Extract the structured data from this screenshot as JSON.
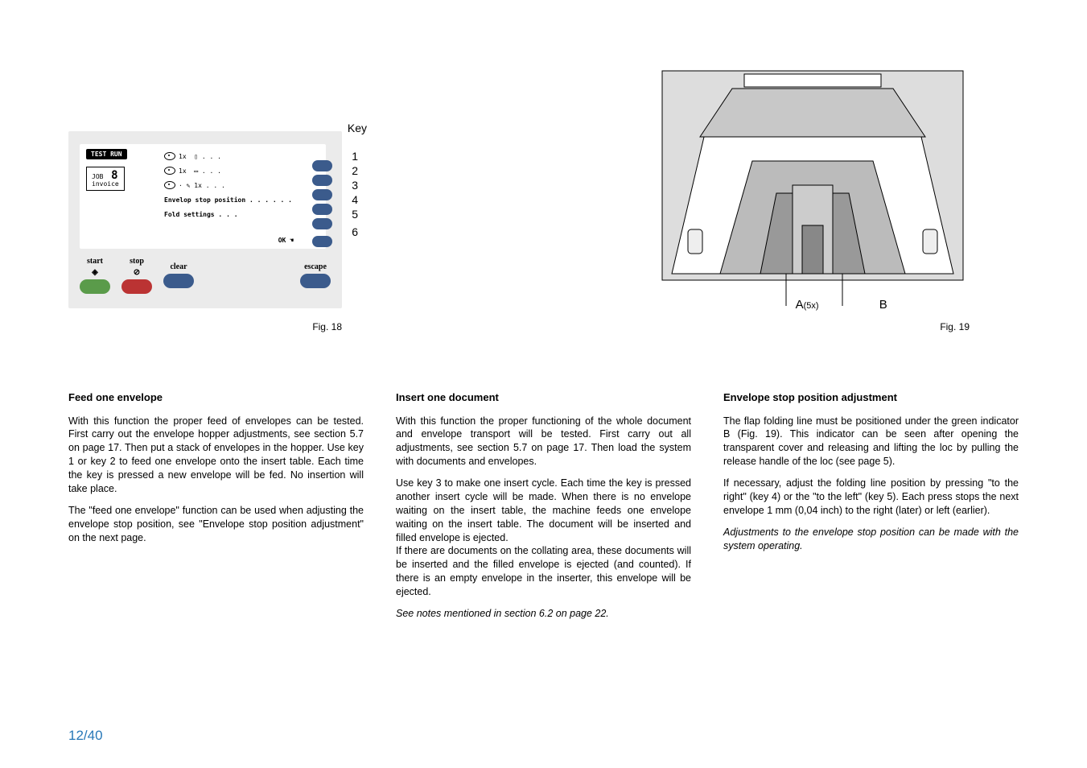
{
  "panel": {
    "test_run": "TEST RUN",
    "job_label": "JOB",
    "job_name": "invoice",
    "job_number": "8",
    "rows": [
      {
        "text": "1x"
      },
      {
        "text": "1x"
      },
      {
        "text": "1x"
      },
      {
        "text": "Envelop stop\nposition . . . . . ."
      },
      {
        "text": "Fold settings . . ."
      }
    ],
    "ok": "OK",
    "key_title": "Key",
    "keys": [
      "1",
      "2",
      "3",
      "4",
      "5",
      "6"
    ],
    "buttons": {
      "start": "start",
      "stop": "stop",
      "clear": "clear",
      "escape": "escape"
    }
  },
  "fig18_caption": "Fig. 18",
  "fig19_caption": "Fig. 19",
  "fig19_labels": {
    "A": "A",
    "A5x": "(5x)",
    "B": "B"
  },
  "col1": {
    "title": "Feed one envelope",
    "p1": "With this function the proper feed of envelopes can be tested. First carry out the envelope hopper adjustments, see section 5.7 on page 17. Then put a stack of envelopes in the hopper. Use key 1 or key 2 to feed one envelope onto the insert table. Each time the key is pressed a new envelope will be fed. No insertion will take place.",
    "p2": "The \"feed one envelope\" function can be used when adjusting the envelope stop position, see \"Envelope stop position adjustment\" on the next page."
  },
  "col2": {
    "title": "Insert one document",
    "p1": "With this function the proper functioning of the whole document and envelope transport will be tested. First carry out all adjustments, see section 5.7 on page 17. Then load the system with documents and envelopes.",
    "p2": "Use key 3 to make one insert cycle. Each time the key is pressed another insert cycle will be made. When there is no envelope waiting on the insert table, the machine feeds one envelope waiting on the insert table. The document will be inserted and filled envelope is ejected.",
    "p3": "If there are documents on the collating area, these documents will be inserted and the filled envelope is ejected (and counted). If there is an empty envelope in the inserter, this envelope will be ejected.",
    "p4": "See notes mentioned in section 6.2 on page 22."
  },
  "col3": {
    "title": "Envelope stop position adjustment",
    "p1": "The flap folding line must be positioned under the green indicator B (Fig. 19). This indicator can be seen after opening the transparent cover and releasing and lifting the loc by pulling the release handle of the loc (see page 5).",
    "p2": "If necessary, adjust the folding line position by pressing \"to the right\" (key 4) or the \"to the left\" (key 5). Each press stops the next envelope 1 mm (0,04 inch) to the right (later) or left (earlier).",
    "p3": "Adjustments to the envelope stop position can be made with the system operating."
  },
  "page_number": "12/40"
}
